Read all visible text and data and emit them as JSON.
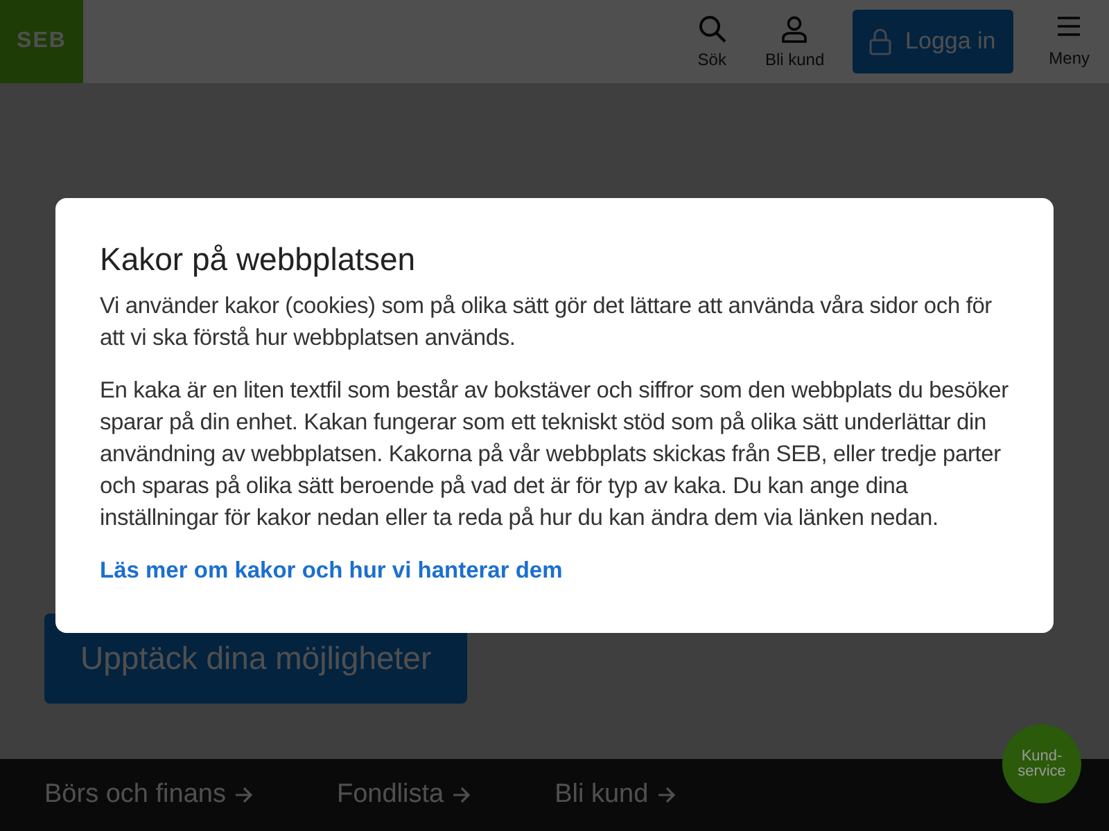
{
  "header": {
    "logo": "SEB",
    "items": [
      {
        "kind": "search",
        "label": "Sök"
      },
      {
        "kind": "user",
        "label": "Bli kund"
      }
    ],
    "login": "Logga in",
    "menu": "Meny"
  },
  "hero": {
    "button": "Upptäck dina möjligheter"
  },
  "footer_links": [
    "Börs och finans",
    "Fondlista",
    "Bli kund"
  ],
  "chat_button": "Kund-service",
  "cookie_dialog": {
    "title": "Kakor på webbplatsen",
    "paragraphs": [
      "Vi använder kakor (cookies) som på olika sätt gör det lättare att använda våra sidor och för att vi ska förstå hur webbplatsen används.",
      "En kaka är en liten textfil som består av bokstäver och siffror som den webbplats du besöker sparar på din enhet. Kakan fungerar som ett tekniskt stöd som på olika sätt underlättar din användning av webbplatsen. Kakorna på vår webbplats skickas från SEB, eller tredje parter och sparas på olika sätt beroende på vad det är för typ av kaka. Du kan ange dina inställningar för kakor nedan eller ta reda på hur du kan ändra dem via länken nedan."
    ],
    "link": "Läs mer om kakor och hur vi hanterar dem"
  }
}
